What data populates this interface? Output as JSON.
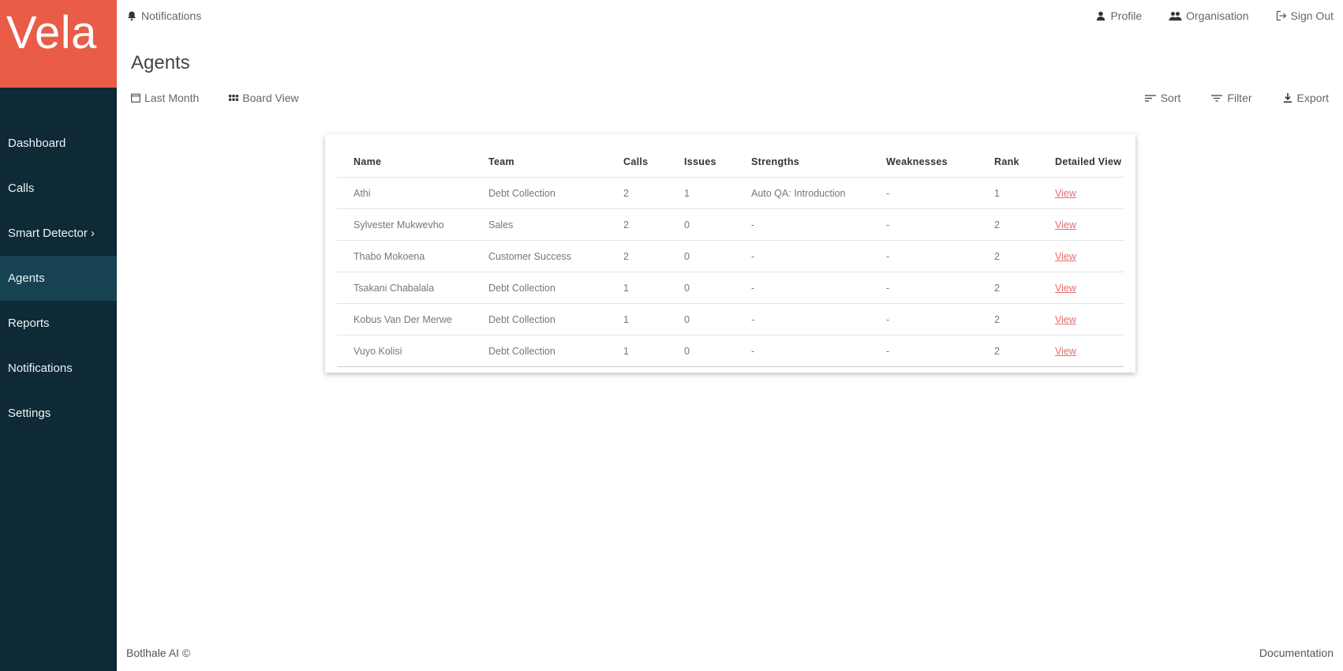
{
  "app": {
    "logo": "Vela"
  },
  "sidebar": {
    "items": [
      {
        "label": "Dashboard"
      },
      {
        "label": "Calls"
      },
      {
        "label": "Smart Detector ›"
      },
      {
        "label": "Agents"
      },
      {
        "label": "Reports"
      },
      {
        "label": "Notifications"
      },
      {
        "label": "Settings"
      }
    ]
  },
  "topbar": {
    "notifications_label": "Notifications",
    "profile_label": "Profile",
    "organisation_label": "Organisation",
    "signout_label": "Sign Out"
  },
  "page": {
    "title": "Agents"
  },
  "toolbar": {
    "last_month_label": "Last Month",
    "board_view_label": "Board View",
    "sort_label": "Sort",
    "filter_label": "Filter",
    "export_label": "Export"
  },
  "table": {
    "headers": [
      "Name",
      "Team",
      "Calls",
      "Issues",
      "Strengths",
      "Weaknesses",
      "Rank",
      "Detailed View"
    ],
    "rows": [
      [
        "Athi",
        "Debt Collection",
        "2",
        "1",
        "Auto QA: Introduction",
        "-",
        "1",
        "View"
      ],
      [
        "Sylvester Mukwevho",
        "Sales",
        "2",
        "0",
        "-",
        "-",
        "2",
        "View"
      ],
      [
        "Thabo Mokoena",
        "Customer Success",
        "2",
        "0",
        "-",
        "-",
        "2",
        "View"
      ],
      [
        "Tsakani Chabalala",
        "Debt Collection",
        "1",
        "0",
        "-",
        "-",
        "2",
        "View"
      ],
      [
        "Kobus Van Der Merwe",
        "Debt Collection",
        "1",
        "0",
        "-",
        "-",
        "2",
        "View"
      ],
      [
        "Vuyo Kolisi",
        "Debt Collection",
        "1",
        "0",
        "-",
        "-",
        "2",
        "View"
      ]
    ]
  },
  "footer": {
    "copyright": "Botlhale AI ©",
    "documentation_label": "Documentation"
  },
  "colors": {
    "sidebar_bg": "#0d2a36",
    "sidebar_active": "#164252",
    "logo_bg": "#e85c48",
    "link": "#e86a6a"
  }
}
